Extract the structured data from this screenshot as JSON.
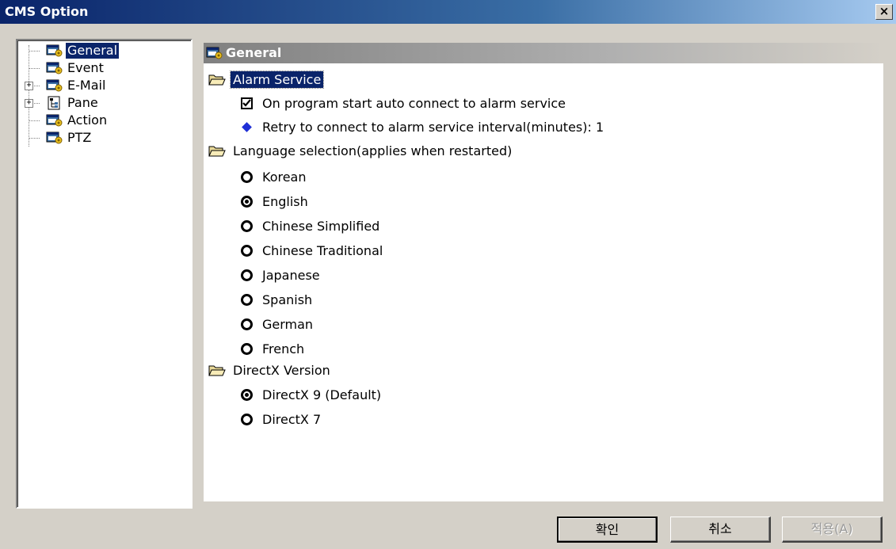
{
  "window": {
    "title": "CMS Option",
    "close_label": "×"
  },
  "tree": {
    "items": [
      {
        "label": "General",
        "icon": "settings-window-icon",
        "selected": true,
        "expandable": false
      },
      {
        "label": "Event",
        "icon": "settings-window-icon",
        "selected": false,
        "expandable": false
      },
      {
        "label": "E-Mail",
        "icon": "settings-window-icon",
        "selected": false,
        "expandable": true
      },
      {
        "label": "Pane",
        "icon": "pane-tree-icon",
        "selected": false,
        "expandable": true
      },
      {
        "label": "Action",
        "icon": "settings-window-icon",
        "selected": false,
        "expandable": false
      },
      {
        "label": "PTZ",
        "icon": "settings-window-icon",
        "selected": false,
        "expandable": false
      }
    ],
    "expander_symbol": "+"
  },
  "content": {
    "header": "General",
    "sections": {
      "alarm": {
        "title": "Alarm Service",
        "auto_connect_label": "On program start auto connect to alarm service",
        "auto_connect_checked": true,
        "retry_label": "Retry to connect to alarm service interval(minutes): 1"
      },
      "language": {
        "title": "Language selection(applies when restarted)",
        "options": [
          "Korean",
          "English",
          "Chinese Simplified",
          "Chinese Traditional",
          "Japanese",
          "Spanish",
          "German",
          "French"
        ],
        "selected": "English"
      },
      "directx": {
        "title": "DirectX Version",
        "options": [
          "DirectX 9 (Default)",
          "DirectX 7"
        ],
        "selected": "DirectX 9 (Default)"
      }
    }
  },
  "buttons": {
    "ok": "확인",
    "cancel": "취소",
    "apply": "적용(A)"
  },
  "colors": {
    "selection": "#0a246a",
    "title_gradient_start": "#0a246a",
    "diamond": "#1f2fd6"
  }
}
